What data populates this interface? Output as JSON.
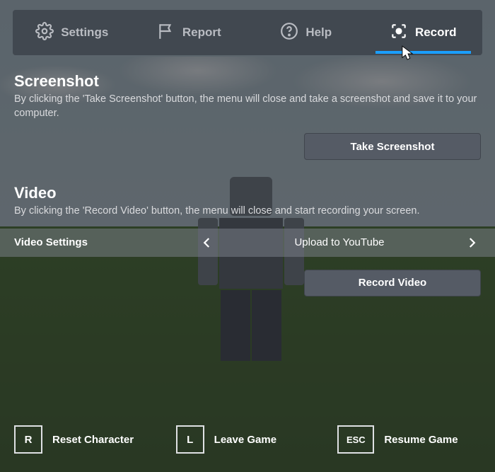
{
  "tabs": {
    "settings": "Settings",
    "report": "Report",
    "help": "Help",
    "record": "Record"
  },
  "screenshot": {
    "title": "Screenshot",
    "desc": "By clicking the 'Take Screenshot' button, the menu will close and take a screenshot and save it to your computer.",
    "button": "Take Screenshot"
  },
  "video": {
    "title": "Video",
    "desc": "By clicking the 'Record Video' button, the menu will close and start recording your screen.",
    "settings_label": "Video Settings",
    "settings_value": "Upload to YouTube",
    "button": "Record Video"
  },
  "bottom": {
    "reset_key": "R",
    "reset_label": "Reset Character",
    "leave_key": "L",
    "leave_label": "Leave Game",
    "resume_key": "ESC",
    "resume_label": "Resume Game"
  }
}
